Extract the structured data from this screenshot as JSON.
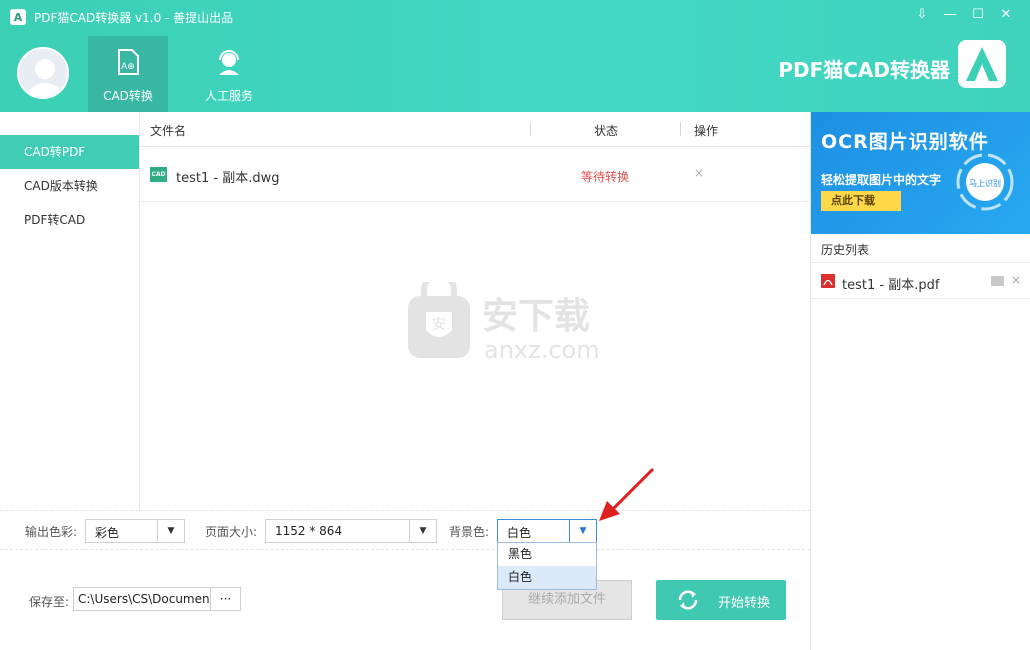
{
  "app": {
    "title": "PDF猫CAD转换器 v1.0 - 善提山出品",
    "brand": "PDF猫CAD转换器",
    "logo_letter": "A"
  },
  "window_controls": [
    "⇩",
    "—",
    "☐",
    "✕"
  ],
  "nav_tabs": [
    {
      "label": "CAD转换",
      "icon": "cad-file-icon",
      "active": true
    },
    {
      "label": "人工服务",
      "icon": "headset-icon",
      "active": false
    }
  ],
  "sidebar": {
    "items": [
      {
        "label": "CAD转PDF",
        "active": true
      },
      {
        "label": "CAD版本转换",
        "active": false
      },
      {
        "label": "PDF转CAD",
        "active": false
      }
    ]
  },
  "table": {
    "headers": {
      "name": "文件名",
      "status": "状态",
      "action": "操作"
    },
    "rows": [
      {
        "icon_text": "CAD",
        "name": "test1 - 副本.dwg",
        "status": "等待转换",
        "action": "×"
      }
    ]
  },
  "watermark": {
    "cn": "安下载",
    "en": "anxz.com"
  },
  "settings": {
    "color_label": "输出色彩:",
    "color_value": "彩色",
    "page_label": "页面大小:",
    "page_value": "1152 * 864",
    "bg_label": "背景色:",
    "bg_value": "白色",
    "bg_options": [
      "黑色",
      "白色"
    ],
    "bg_highlighted": "白色"
  },
  "save": {
    "label": "保存至:",
    "path": "C:\\Users\\CS\\Document",
    "browse": "···"
  },
  "buttons": {
    "add": "继续添加文件",
    "start": "开始转换"
  },
  "right_panel": {
    "ad": {
      "title": "OCR图片识别软件",
      "subtitle": "轻松提取图片中的文字",
      "button": "点此下载",
      "badge_text": "马上识别"
    },
    "history_title": "历史列表",
    "history": [
      {
        "name": "test1 - 副本.pdf"
      }
    ]
  },
  "colors": {
    "accent": "#40cdb6",
    "status_waiting": "#e05050",
    "ad_bg": "#1e8fe3",
    "arrow": "#e02020"
  }
}
